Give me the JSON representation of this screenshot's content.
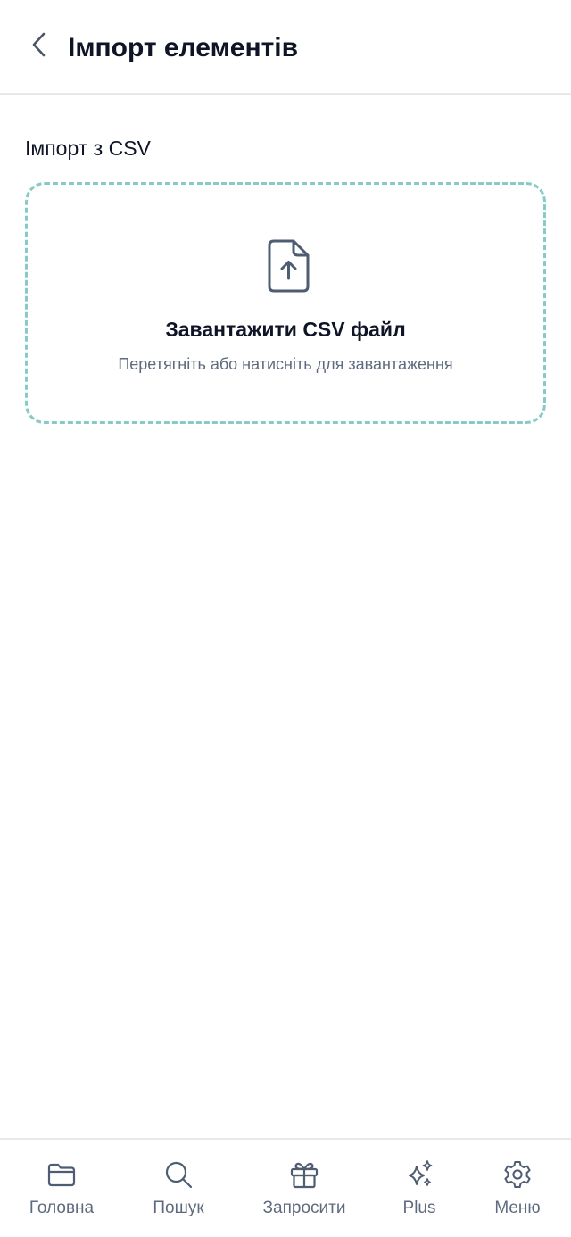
{
  "header": {
    "title": "Імпорт елементів",
    "back_icon": "chevron-left-icon"
  },
  "section": {
    "title": "Імпорт з CSV"
  },
  "dropzone": {
    "icon": "file-upload-icon",
    "title": "Завантажити CSV файл",
    "subtitle": "Перетягніть або натисніть для завантаження",
    "border_color": "#86cbc6"
  },
  "bottom_nav": {
    "items": [
      {
        "label": "Головна",
        "icon": "folder-icon"
      },
      {
        "label": "Пошук",
        "icon": "search-icon"
      },
      {
        "label": "Запросити",
        "icon": "gift-icon"
      },
      {
        "label": "Plus",
        "icon": "sparkles-icon"
      },
      {
        "label": "Меню",
        "icon": "gear-icon"
      }
    ]
  },
  "colors": {
    "text_primary": "#0f1526",
    "text_secondary": "#5e6b7f",
    "divider": "#e6e8ec",
    "accent": "#86cbc6"
  }
}
